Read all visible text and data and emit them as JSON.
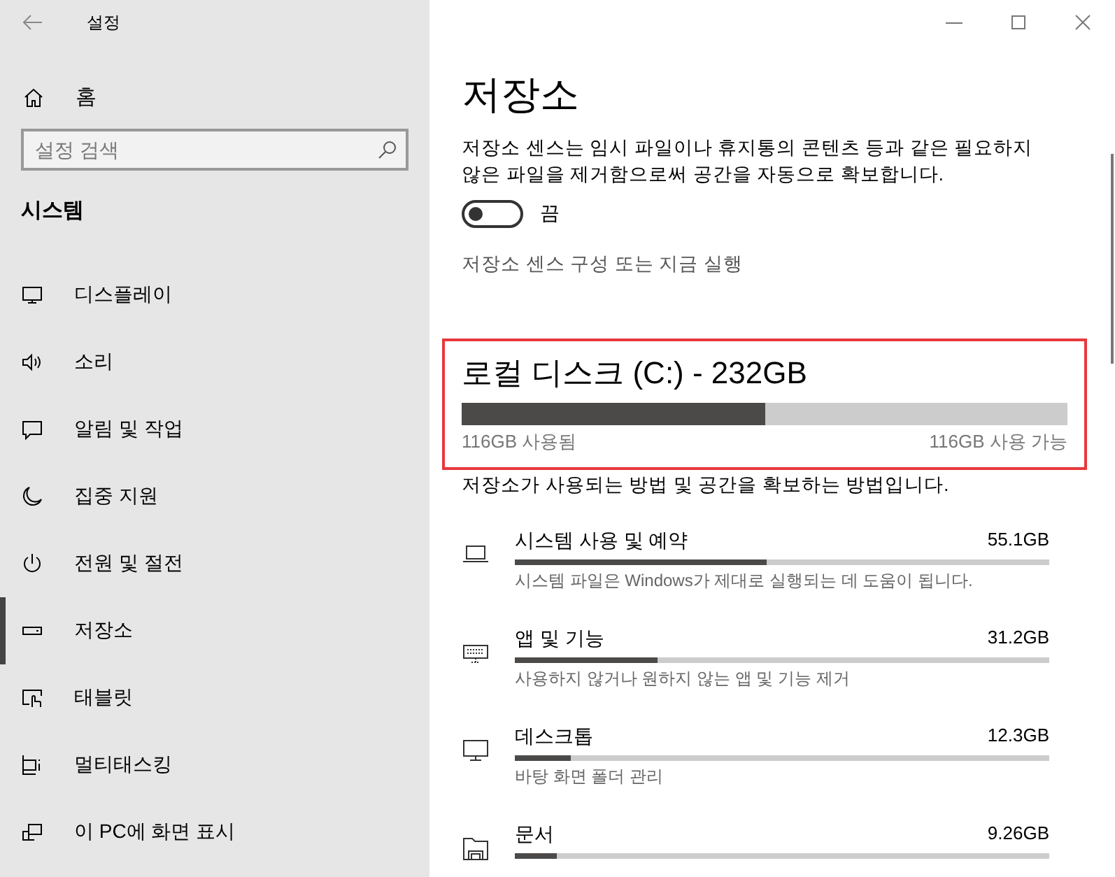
{
  "window": {
    "title": "설정"
  },
  "sidebar": {
    "home": "홈",
    "search": {
      "placeholder": "설정 검색"
    },
    "section": "시스템",
    "items": [
      {
        "label": "디스플레이",
        "kind": "display",
        "selected": false
      },
      {
        "label": "소리",
        "kind": "sound",
        "selected": false
      },
      {
        "label": "알림 및 작업",
        "kind": "notify",
        "selected": false
      },
      {
        "label": "집중 지원",
        "kind": "moon",
        "selected": false
      },
      {
        "label": "전원 및 절전",
        "kind": "power",
        "selected": false
      },
      {
        "label": "저장소",
        "kind": "storage",
        "selected": true
      },
      {
        "label": "태블릿",
        "kind": "tablet",
        "selected": false
      },
      {
        "label": "멀티태스킹",
        "kind": "multitask",
        "selected": false
      },
      {
        "label": "이 PC에 화면 표시",
        "kind": "project",
        "selected": false
      }
    ]
  },
  "page": {
    "title": "저장소",
    "description": "저장소 센스는 임시 파일이나 휴지통의 콘텐츠 등과 같은 필요하지 않은 파일을 제거함으로써 공간을 자동으로 확보합니다.",
    "toggle": {
      "on": false,
      "label": "끔"
    },
    "link": "저장소 센스 구성 또는 지금 실행",
    "disk": {
      "title": "로컬 디스크 (C:) - 232GB",
      "level": 0.5,
      "used": "116GB 사용됨",
      "free": "116GB 사용 가능"
    },
    "usage_intro": "저장소가 사용되는 방법 및 공간을 확보하는 방법입니다.",
    "categories": [
      {
        "kind": "laptop",
        "name": "시스템 사용 및 예약",
        "size": "55.1GB",
        "level": 0.47,
        "description": "시스템 파일은 Windows가 제대로 실행되는 데 도움이 됩니다."
      },
      {
        "kind": "keyboard",
        "name": "앱 및 기능",
        "size": "31.2GB",
        "level": 0.267,
        "description": "사용하지 않거나 원하지 않는 앱 및 기능 제거"
      },
      {
        "kind": "monitor",
        "name": "데스크톱",
        "size": "12.3GB",
        "level": 0.105,
        "description": "바탕 화면 폴더 관리"
      },
      {
        "kind": "folder",
        "name": "문서",
        "size": "9.26GB",
        "level": 0.079
      }
    ]
  }
}
